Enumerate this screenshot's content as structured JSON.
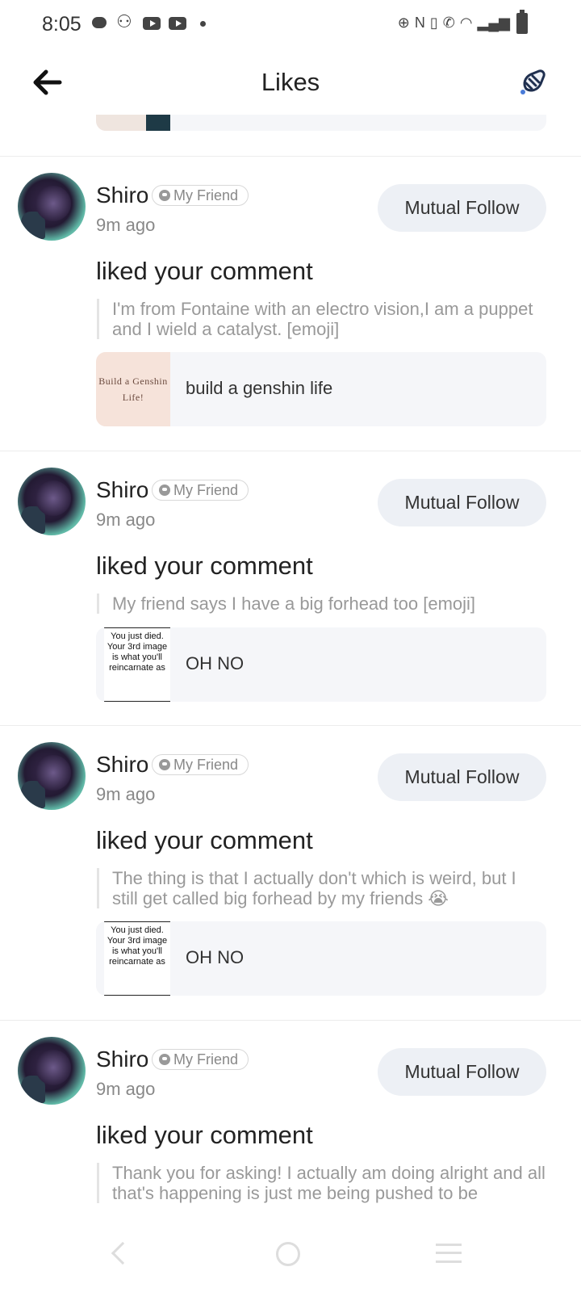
{
  "status_bar": {
    "time": "8:05"
  },
  "header": {
    "title": "Likes"
  },
  "items": [
    {
      "user": "Shiro",
      "badge": "My Friend",
      "time": "9m ago",
      "follow_label": "Mutual Follow",
      "action": "liked your comment",
      "comment": "I'm from Fontaine with an electro vision,I am a puppet and I wield a catalyst. [emoji]",
      "post_thumb_text": "Build a Genshin Life!",
      "post_title": "build a genshin life"
    },
    {
      "user": "Shiro",
      "badge": "My Friend",
      "time": "9m ago",
      "follow_label": "Mutual Follow",
      "action": "liked your comment",
      "comment": "My friend says I have a big forhead too [emoji]",
      "post_thumb_text": "You just died. Your 3rd image is what you'll reincarnate as",
      "post_title": "OH NO"
    },
    {
      "user": "Shiro",
      "badge": "My Friend",
      "time": "9m ago",
      "follow_label": "Mutual Follow",
      "action": "liked your comment",
      "comment": "The thing is that I actually don't which is weird, but I still get called big forhead by my friends 😭",
      "post_thumb_text": "You just died. Your 3rd image is what you'll reincarnate as",
      "post_title": "OH NO"
    },
    {
      "user": "Shiro",
      "badge": "My Friend",
      "time": "9m ago",
      "follow_label": "Mutual Follow",
      "action": "liked your comment",
      "comment": "Thank you for asking! I actually am doing alright and all that's happening is just me being pushed to be"
    }
  ]
}
